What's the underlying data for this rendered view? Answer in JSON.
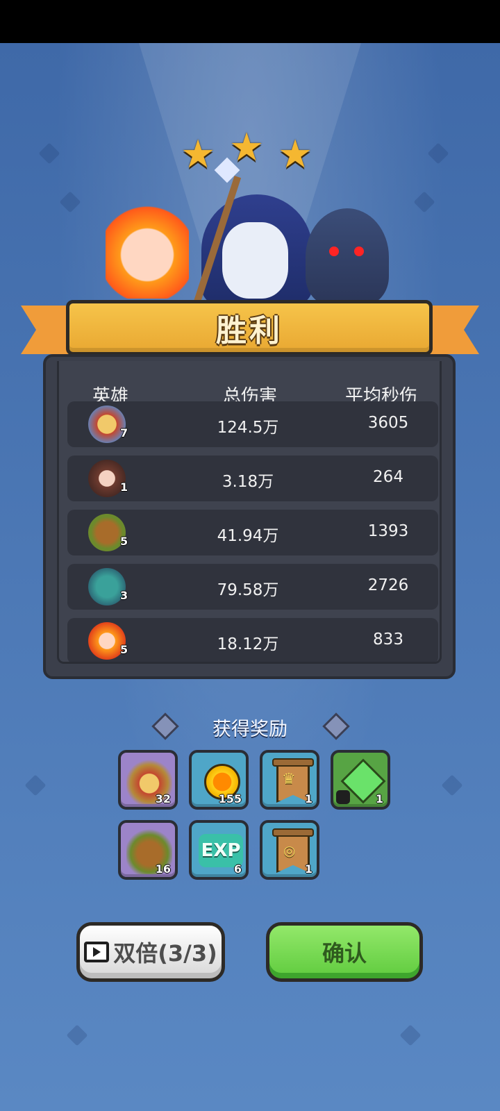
{
  "result": {
    "title": "胜利",
    "stars": 3,
    "star_glyph": "★"
  },
  "stats": {
    "headers": {
      "hero": "英雄",
      "total_damage": "总伤害",
      "avg_dps": "平均秒伤"
    },
    "rows": [
      {
        "hero_icon": "viking-warrior-icon",
        "level": "7",
        "total_damage": "124.5万",
        "avg_dps": "3605"
      },
      {
        "hero_icon": "hooded-archer-icon",
        "level": "1",
        "total_damage": "3.18万",
        "avg_dps": "264"
      },
      {
        "hero_icon": "treant-icon",
        "level": "5",
        "total_damage": "41.94万",
        "avg_dps": "1393"
      },
      {
        "hero_icon": "bird-druid-icon",
        "level": "3",
        "total_damage": "79.58万",
        "avg_dps": "2726"
      },
      {
        "hero_icon": "fire-spirit-icon",
        "level": "5",
        "total_damage": "18.12万",
        "avg_dps": "833"
      }
    ]
  },
  "rewards": {
    "title": "获得奖励",
    "items": [
      {
        "icon": "viking-warrior-shard-icon",
        "count": "32",
        "rarity": "purple"
      },
      {
        "icon": "gold-coin-icon",
        "count": "155",
        "rarity": "blue"
      },
      {
        "icon": "crown-banner-icon",
        "count": "1",
        "rarity": "blue"
      },
      {
        "icon": "green-gem-icon",
        "count": "1",
        "rarity": "green"
      },
      {
        "icon": "treant-shard-icon",
        "count": "16",
        "rarity": "purple"
      },
      {
        "icon": "exp-icon",
        "count": "6",
        "rarity": "blue",
        "text": "EXP"
      },
      {
        "icon": "ring-banner-icon",
        "count": "1",
        "rarity": "blue"
      }
    ]
  },
  "buttons": {
    "double_label": "双倍(3/3)",
    "confirm_label": "确认"
  },
  "colors": {
    "background": "#4f7bb8",
    "banner": "#f6c44a",
    "panel": "#3b3f4b",
    "confirm_button": "#6fd84a"
  }
}
